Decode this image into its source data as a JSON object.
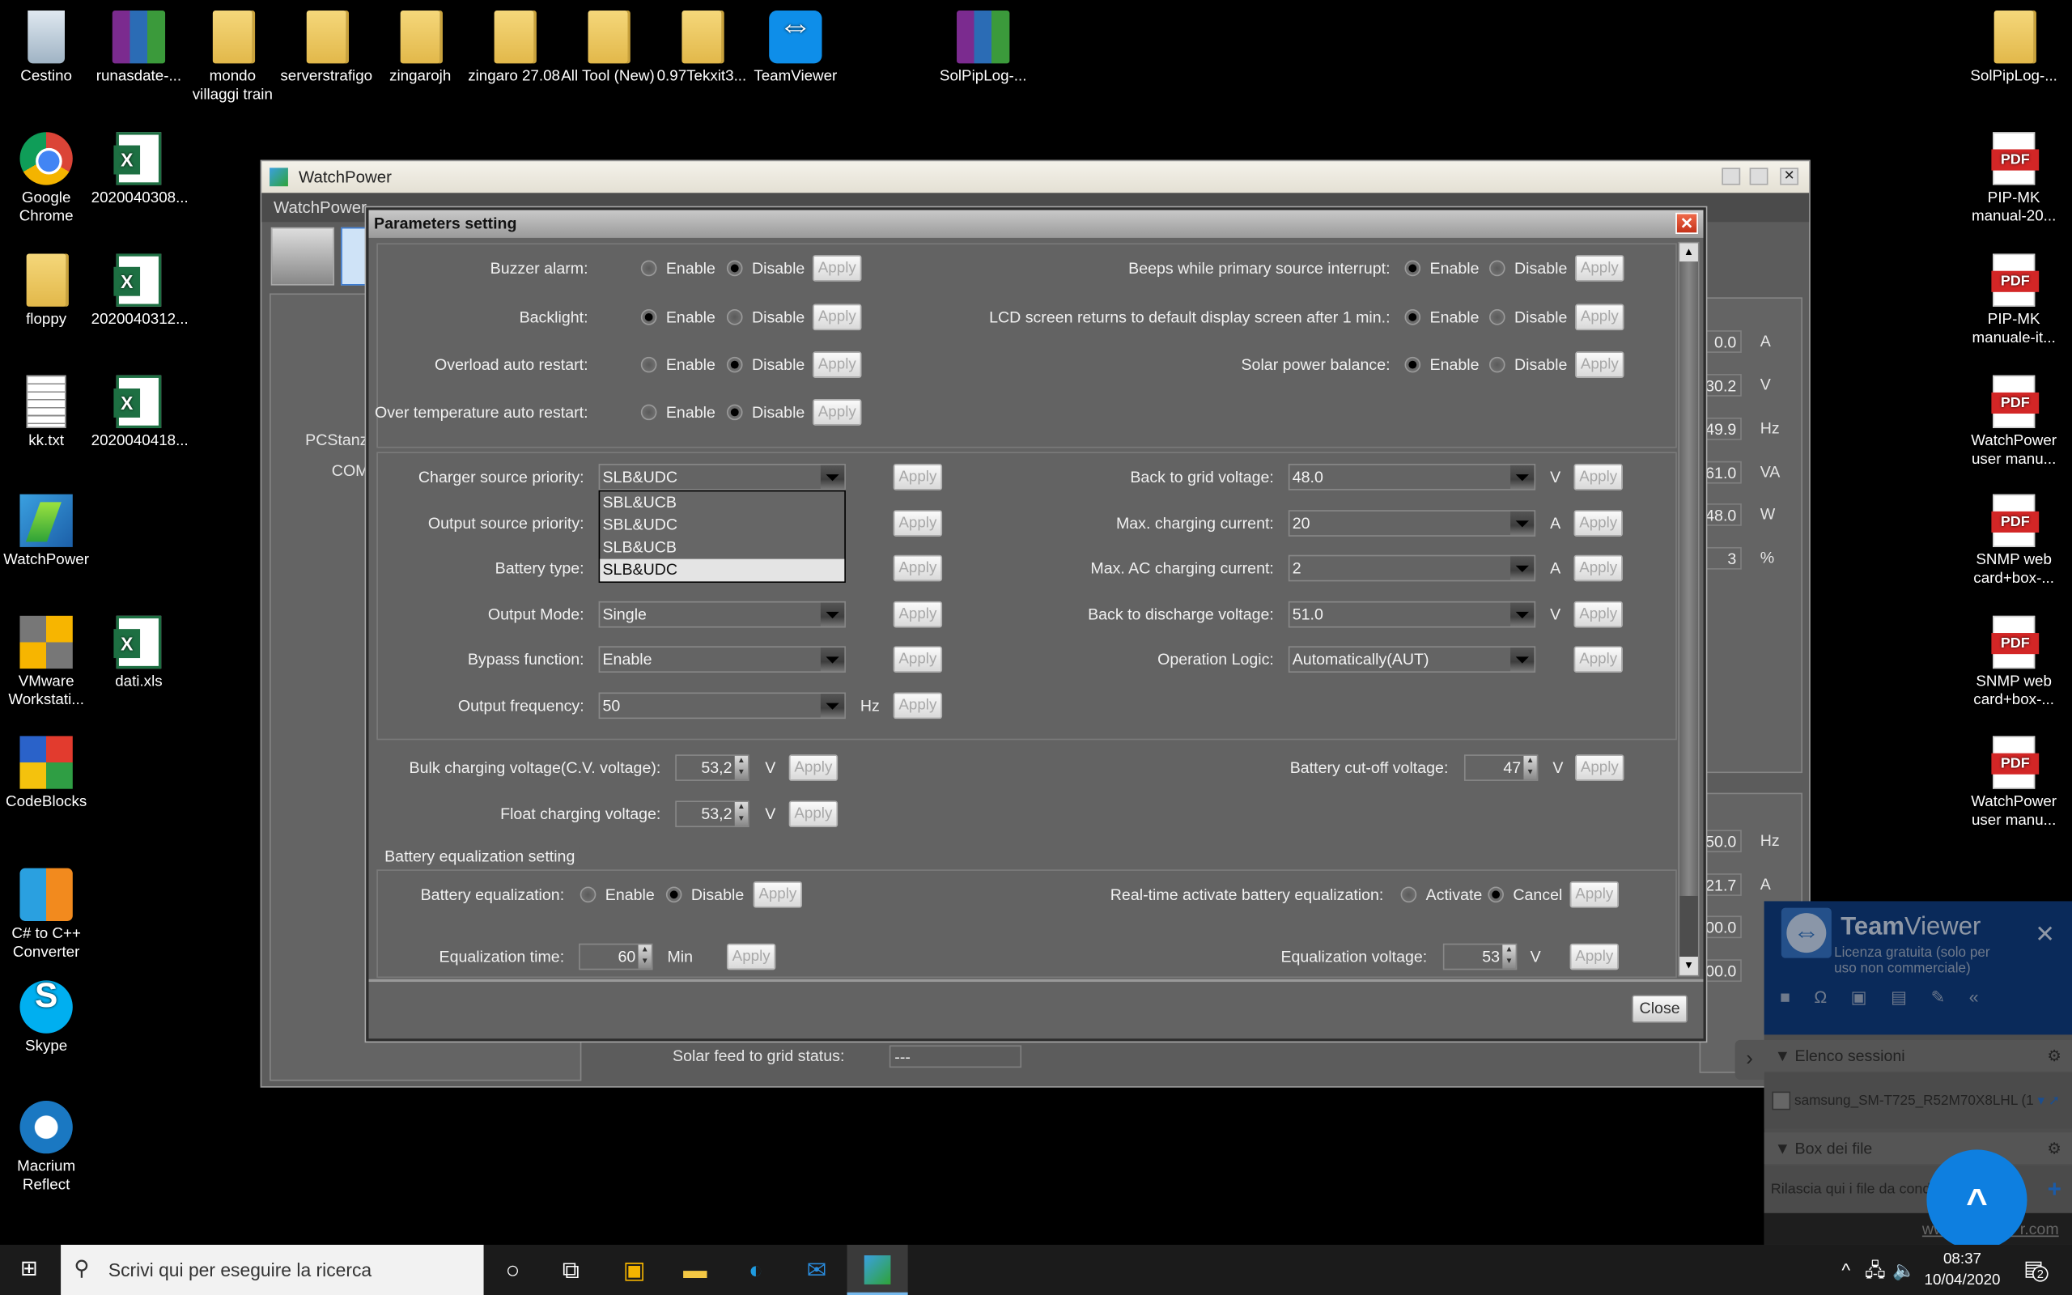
{
  "desktop": {
    "icons": [
      {
        "label": "Cestino",
        "type": "recycle-bin"
      },
      {
        "label": "runasdate-...",
        "type": "rar"
      },
      {
        "label": "mondo villaggi train",
        "type": "folder"
      },
      {
        "label": "serverstrafigo",
        "type": "folder"
      },
      {
        "label": "zingarojh",
        "type": "folder"
      },
      {
        "label": "zingaro 27.08",
        "type": "folder"
      },
      {
        "label": "All Tool (New)",
        "type": "folder"
      },
      {
        "label": "0.97Tekxit3...",
        "type": "folder"
      },
      {
        "label": "TeamViewer",
        "type": "teamviewer"
      },
      {
        "label": "SolPipLog-...",
        "type": "rar"
      },
      {
        "label": "Google Chrome",
        "type": "chrome"
      },
      {
        "label": "2020040308...",
        "type": "xls"
      },
      {
        "label": "floppy",
        "type": "folder"
      },
      {
        "label": "2020040312...",
        "type": "xls"
      },
      {
        "label": "kk.txt",
        "type": "txt"
      },
      {
        "label": "2020040418...",
        "type": "xls"
      },
      {
        "label": "WatchPower",
        "type": "watchpower"
      },
      {
        "label": "VMware Workstati...",
        "type": "vmware"
      },
      {
        "label": "dati.xls",
        "type": "xls"
      },
      {
        "label": "CodeBlocks",
        "type": "codeblocks"
      },
      {
        "label": "C# to C++ Converter",
        "type": "converter"
      },
      {
        "label": "Skype",
        "type": "skype"
      },
      {
        "label": "Macrium Reflect",
        "type": "macrium"
      },
      {
        "label": "SolPipLog-...",
        "type": "folder"
      },
      {
        "label": "PIP-MK manual-20...",
        "type": "pdf"
      },
      {
        "label": "PIP-MK manuale-it...",
        "type": "pdf"
      },
      {
        "label": "WatchPower user manu...",
        "type": "pdf"
      },
      {
        "label": "SNMP web card+box-...",
        "type": "pdf"
      },
      {
        "label": "SNMP web card+box-...",
        "type": "pdf"
      },
      {
        "label": "WatchPower user manu...",
        "type": "pdf"
      }
    ]
  },
  "watchpower": {
    "title": "WatchPower",
    "menu_first": "WatchPower",
    "tree": [
      "PCStanz",
      "COM"
    ],
    "readouts": [
      {
        "value": "0.0",
        "unit": "A"
      },
      {
        "value": "30.2",
        "unit": "V"
      },
      {
        "value": "49.9",
        "unit": "Hz"
      },
      {
        "value": "61.0",
        "unit": "VA"
      },
      {
        "value": "48.0",
        "unit": "W"
      },
      {
        "value": "3",
        "unit": "%"
      },
      {
        "value": "50.0",
        "unit": "Hz"
      },
      {
        "value": "21.7",
        "unit": "A"
      },
      {
        "value": "000.0",
        "unit": ""
      },
      {
        "value": "000.0",
        "unit": ""
      }
    ],
    "solar_feed_label": "Solar feed to grid status:",
    "solar_feed_value": "---"
  },
  "dialog": {
    "title": "Parameters setting",
    "apply": "Apply",
    "close": "Close",
    "enable": "Enable",
    "disable": "Disable",
    "toggles_left": [
      {
        "label": "Buzzer alarm:",
        "value": "Disable"
      },
      {
        "label": "Backlight:",
        "value": "Enable"
      },
      {
        "label": "Overload auto restart:",
        "value": "Disable"
      },
      {
        "label": "Over temperature auto restart:",
        "value": "Disable"
      }
    ],
    "toggles_right": [
      {
        "label": "Beeps while primary source interrupt:",
        "value": "Enable"
      },
      {
        "label": "LCD screen returns to default display screen after 1 min.:",
        "value": "Enable"
      },
      {
        "label": "Solar power balance:",
        "value": "Enable"
      }
    ],
    "combos_left": [
      {
        "label": "Charger source priority:",
        "value": "SLB&UDC",
        "unit": ""
      },
      {
        "label": "Output source priority:",
        "value": "",
        "unit": ""
      },
      {
        "label": "Battery type:",
        "value": "",
        "unit": ""
      },
      {
        "label": "Output Mode:",
        "value": "Single",
        "unit": ""
      },
      {
        "label": "Bypass function:",
        "value": "Enable",
        "unit": ""
      },
      {
        "label": "Output frequency:",
        "value": "50",
        "unit": "Hz"
      }
    ],
    "charger_dropdown": {
      "options": [
        "SBL&UCB",
        "SBL&UDC",
        "SLB&UCB",
        "SLB&UDC"
      ],
      "selected": "SLB&UDC"
    },
    "combos_right": [
      {
        "label": "Back to grid voltage:",
        "value": "48.0",
        "unit": "V"
      },
      {
        "label": "Max. charging current:",
        "value": "20",
        "unit": "A"
      },
      {
        "label": "Max. AC charging current:",
        "value": "2",
        "unit": "A"
      },
      {
        "label": "Back to discharge voltage:",
        "value": "51.0",
        "unit": "V"
      },
      {
        "label": "Operation Logic:",
        "value": "Automatically(AUT)",
        "unit": ""
      }
    ],
    "bulk": {
      "label": "Bulk charging voltage(C.V. voltage):",
      "value": "53,2",
      "unit": "V"
    },
    "float": {
      "label": "Float charging voltage:",
      "value": "53,2",
      "unit": "V"
    },
    "cutoff": {
      "label": "Battery cut-off voltage:",
      "value": "47",
      "unit": "V"
    },
    "eq_group": "Battery equalization setting",
    "eq": {
      "label": "Battery equalization:",
      "value": "Disable"
    },
    "rt_eq": {
      "label": "Real-time activate battery equalization:",
      "activate": "Activate",
      "cancel": "Cancel",
      "value": "Cancel"
    },
    "eq_time": {
      "label": "Equalization time:",
      "value": "60",
      "unit": "Min"
    },
    "eq_voltage": {
      "label": "Equalization voltage:",
      "value": "53",
      "unit": "V"
    }
  },
  "teamviewer": {
    "brand_bold": "Team",
    "brand_light": "Viewer",
    "license": "Licenza gratuita (solo per uso non commerciale)",
    "sessions_header": "Elenco sessioni",
    "session_item": "samsung_SM-T725_R52M70X8LHL (1",
    "files_header": "Box dei file",
    "files_drop": "Rilascia qui i file da cond",
    "footer_link": "ww                 r.com"
  },
  "taskbar": {
    "search_placeholder": "Scrivi qui per eseguire la ricerca",
    "time": "08:37",
    "date": "10/04/2020",
    "notifications": "2"
  },
  "colors": {
    "accent": "#0e7fe0",
    "dialog_bg": "#636363",
    "teamviewer_bg": "#0a2a5a"
  }
}
